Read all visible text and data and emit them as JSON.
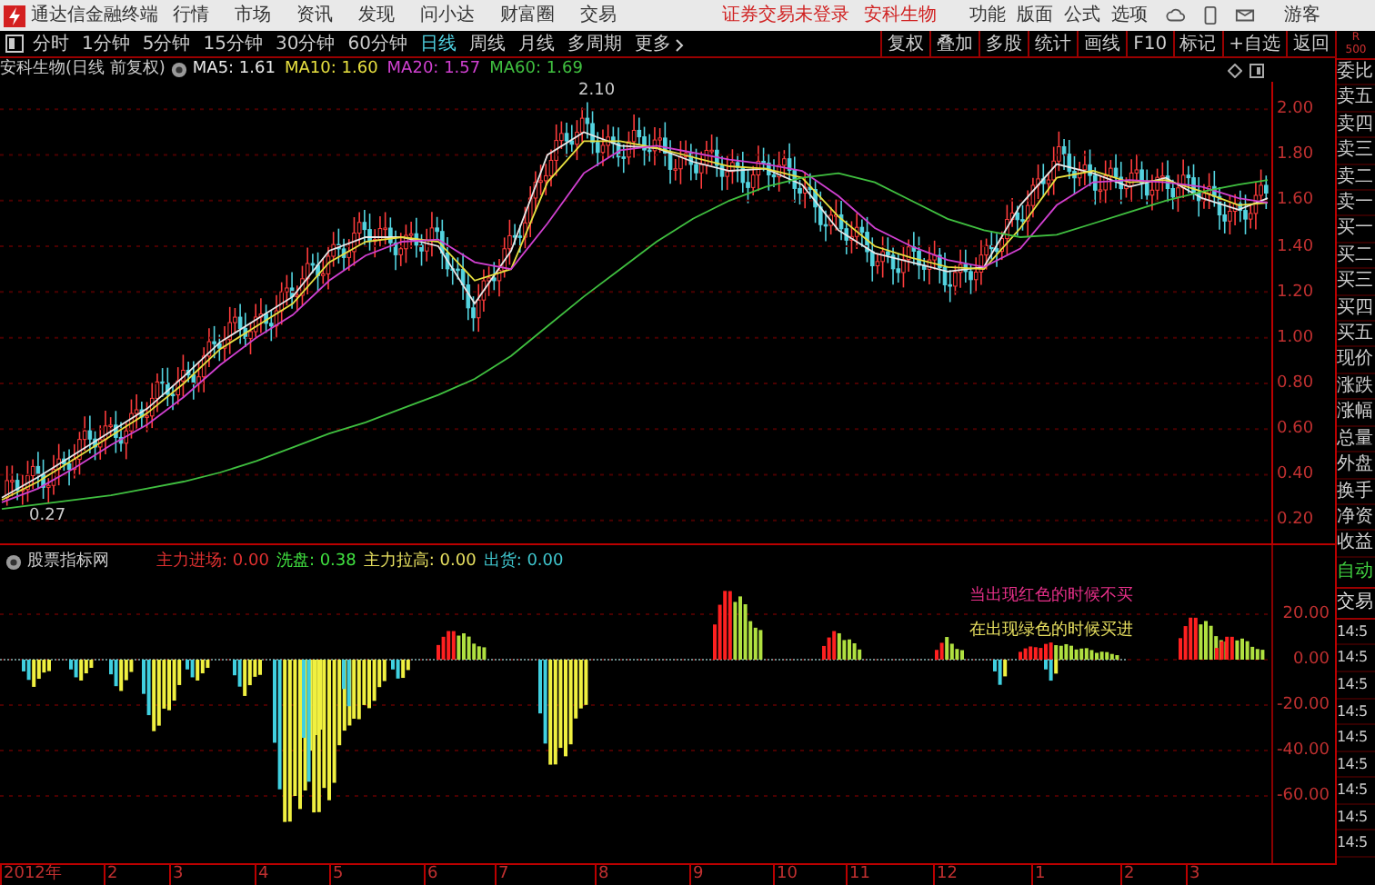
{
  "title_bar": {
    "app_name": "通达信金融终端",
    "menu": [
      "行情",
      "市场",
      "资讯",
      "发现",
      "问小达",
      "财富圈",
      "交易"
    ],
    "notices": [
      "证券交易未登录",
      "安科生物"
    ],
    "right_menu": [
      "功能",
      "版面",
      "公式",
      "选项"
    ],
    "user": "游客"
  },
  "period_tabs": [
    {
      "label": "分时",
      "selected": false
    },
    {
      "label": "1分钟",
      "selected": false
    },
    {
      "label": "5分钟",
      "selected": false
    },
    {
      "label": "15分钟",
      "selected": false
    },
    {
      "label": "30分钟",
      "selected": false
    },
    {
      "label": "60分钟",
      "selected": false
    },
    {
      "label": "日线",
      "selected": true
    },
    {
      "label": "周线",
      "selected": false
    },
    {
      "label": "月线",
      "selected": false
    },
    {
      "label": "多周期",
      "selected": false
    },
    {
      "label": "更多",
      "selected": false
    }
  ],
  "tools": [
    "复权",
    "叠加",
    "多股",
    "统计",
    "画线",
    "F10",
    "标记",
    "+自选",
    "返回"
  ],
  "corner_label": [
    "R",
    "500"
  ],
  "price_chart": {
    "title": "安科生物(日线 前复权)",
    "ma": [
      {
        "label": "MA5: 1.61"
      },
      {
        "label": "MA10: 1.60"
      },
      {
        "label": "MA20: 1.57"
      },
      {
        "label": "MA60: 1.69"
      }
    ],
    "high_label": "2.10",
    "low_label": "0.27",
    "chart_data": {
      "type": "line",
      "ylim": [
        0.1,
        2.12
      ],
      "grid": true,
      "yticks": [
        {
          "value": 2.0,
          "label": "2.00"
        },
        {
          "value": 1.8,
          "label": "1.80"
        },
        {
          "value": 1.6,
          "label": "1.60"
        },
        {
          "value": 1.4,
          "label": "1.40"
        },
        {
          "value": 1.2,
          "label": "1.20"
        },
        {
          "value": 1.0,
          "label": "1.00"
        },
        {
          "value": 0.8,
          "label": "0.80"
        },
        {
          "value": 0.6,
          "label": "0.60"
        },
        {
          "value": 0.4,
          "label": "0.40"
        },
        {
          "value": 0.2,
          "label": "0.20"
        }
      ],
      "series": [
        {
          "color": "#e8e8e8",
          "values": [
            0.3,
            0.39,
            0.49,
            0.59,
            0.69,
            0.83,
            0.98,
            1.08,
            1.18,
            1.38,
            1.44,
            1.44,
            1.4,
            1.15,
            1.38,
            1.8,
            1.9,
            1.84,
            1.83,
            1.77,
            1.73,
            1.74,
            1.67,
            1.47,
            1.37,
            1.33,
            1.29,
            1.31,
            1.58,
            1.76,
            1.72,
            1.66,
            1.7,
            1.61,
            1.56,
            1.61
          ]
        },
        {
          "color": "#e8e040",
          "values": [
            0.29,
            0.37,
            0.47,
            0.57,
            0.67,
            0.8,
            0.95,
            1.05,
            1.15,
            1.33,
            1.42,
            1.44,
            1.42,
            1.25,
            1.3,
            1.68,
            1.86,
            1.86,
            1.83,
            1.79,
            1.75,
            1.74,
            1.7,
            1.53,
            1.4,
            1.35,
            1.31,
            1.3,
            1.48,
            1.7,
            1.73,
            1.68,
            1.69,
            1.64,
            1.58,
            1.59
          ]
        },
        {
          "color": "#d040d0",
          "values": [
            0.28,
            0.34,
            0.43,
            0.53,
            0.62,
            0.74,
            0.88,
            1.0,
            1.1,
            1.25,
            1.36,
            1.42,
            1.43,
            1.33,
            1.3,
            1.5,
            1.72,
            1.82,
            1.84,
            1.81,
            1.78,
            1.76,
            1.73,
            1.62,
            1.48,
            1.4,
            1.34,
            1.31,
            1.39,
            1.58,
            1.68,
            1.69,
            1.68,
            1.66,
            1.61,
            1.59
          ]
        },
        {
          "color": "#40c040",
          "values": [
            0.25,
            0.27,
            0.29,
            0.31,
            0.34,
            0.37,
            0.41,
            0.46,
            0.52,
            0.58,
            0.63,
            0.69,
            0.75,
            0.82,
            0.92,
            1.05,
            1.18,
            1.3,
            1.42,
            1.52,
            1.6,
            1.66,
            1.7,
            1.72,
            1.68,
            1.6,
            1.52,
            1.47,
            1.44,
            1.45,
            1.5,
            1.55,
            1.6,
            1.64,
            1.67,
            1.69
          ]
        }
      ]
    }
  },
  "indicator": {
    "title": "股票指标网",
    "values": [
      {
        "label": "主力进场: 0.00",
        "color": "#e03030"
      },
      {
        "label": "洗盘: 0.38",
        "color": "#40e040"
      },
      {
        "label": "主力拉高: 0.00",
        "color": "#e8e060"
      },
      {
        "label": "出货: 0.00",
        "color": "#40c8d0"
      }
    ],
    "notes": [
      {
        "text": "当出现红色的时候不买",
        "color": "#e8308a"
      },
      {
        "text": "在出现绿色的时候买进",
        "color": "#e8e060"
      }
    ],
    "axis_labels": [
      "20.00",
      "0.00",
      "-20.00",
      "-40.00",
      "-60.00"
    ]
  },
  "x_axis": [
    "2012年",
    "2",
    "3",
    "4",
    "5",
    "6",
    "7",
    "8",
    "9",
    "10",
    "11",
    "12",
    "1",
    "2",
    "3"
  ],
  "side_panel": {
    "quote_labels": [
      "委比",
      "卖五",
      "卖四",
      "卖三",
      "卖二",
      "卖一",
      "买一",
      "买二",
      "买三",
      "买四",
      "买五",
      "现价",
      "涨跌",
      "涨幅",
      "总量",
      "外盘",
      "换手",
      "净资",
      "收益"
    ],
    "trade_labels": [
      "自动",
      "交易"
    ],
    "times": [
      "14:5",
      "14:5",
      "14:5",
      "14:5",
      "14:5",
      "14:5",
      "14:5",
      "14:5",
      "14:5"
    ]
  }
}
